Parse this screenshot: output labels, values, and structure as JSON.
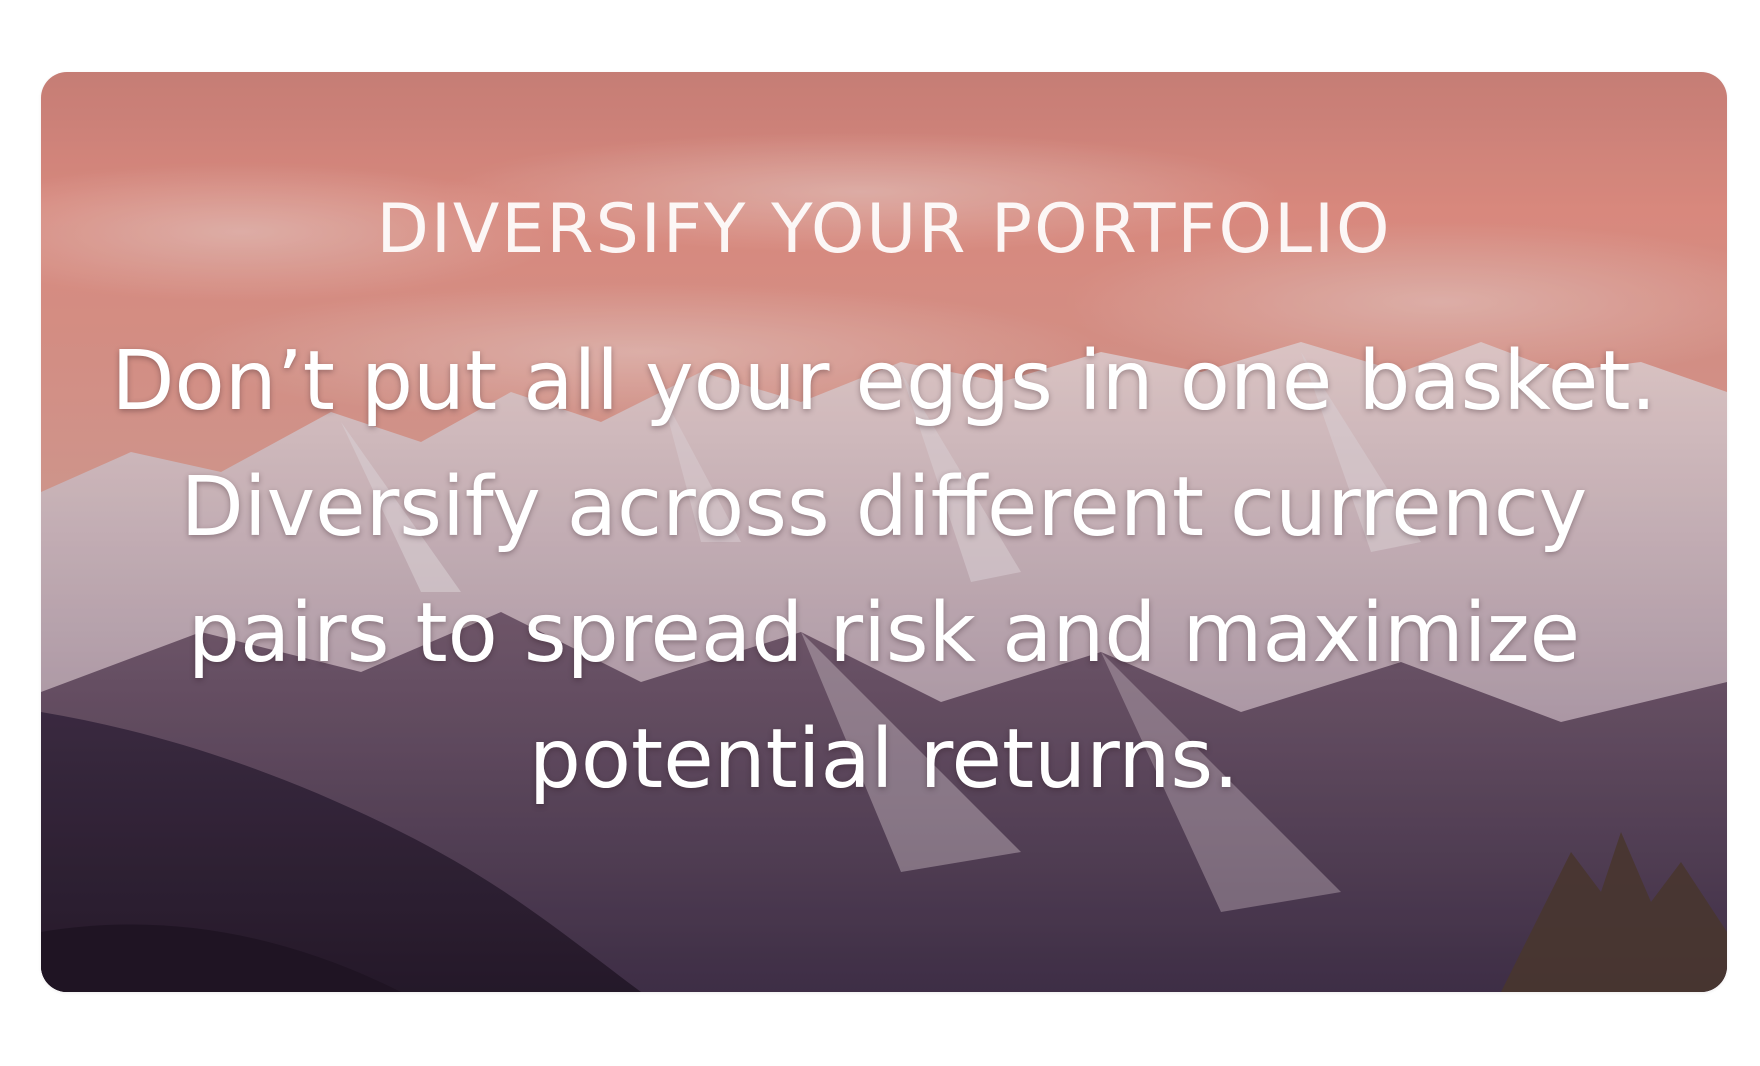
{
  "tip_card": {
    "eyebrow": "DIVERSIFY YOUR PORTFOLIO",
    "message": "Don’t put all your eggs in one basket. Diversify across different currency pairs to spread risk and maximize potential returns.",
    "background": "mountain-landscape-image",
    "colors": {
      "sky_top": "#EE9787",
      "sky_mid": "#E7A091",
      "snow": "#E9E2E4",
      "ridge": "#4A3850",
      "forest": "#2F2238"
    }
  }
}
